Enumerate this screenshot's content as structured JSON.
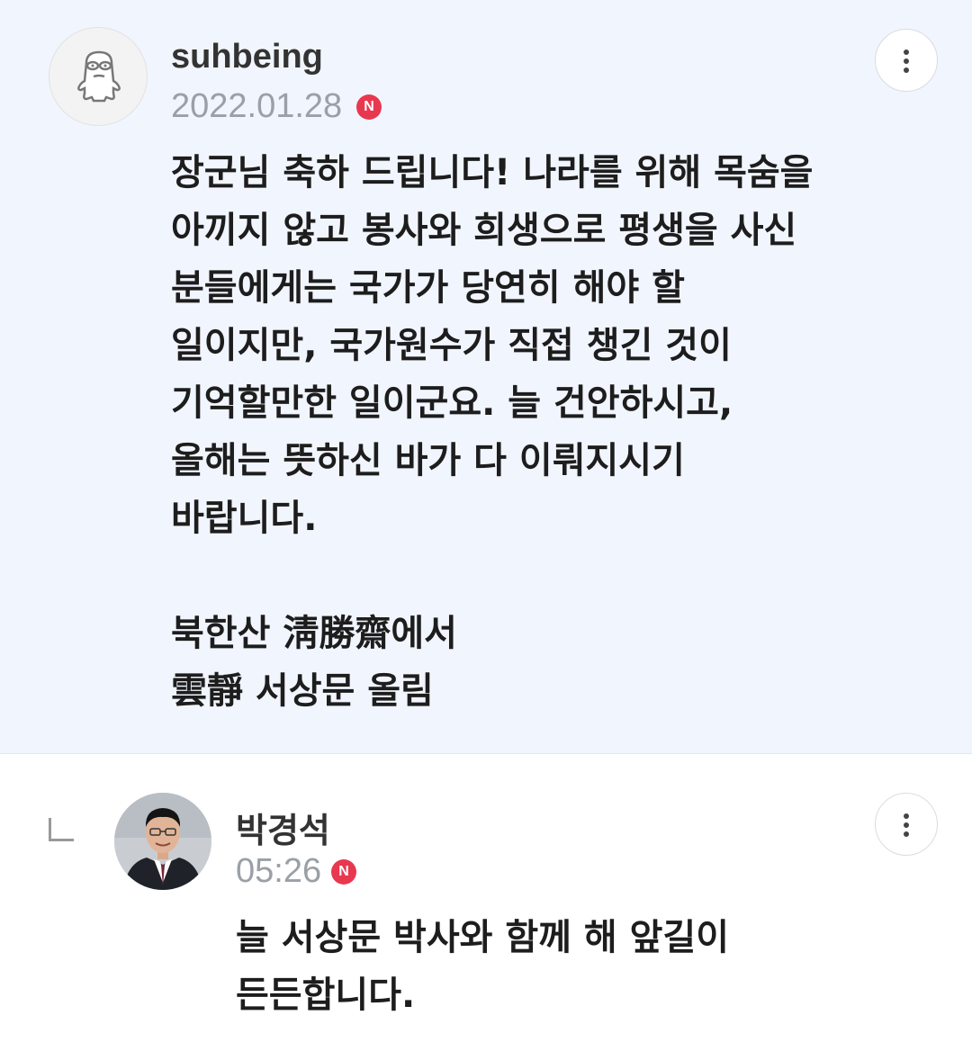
{
  "comments": [
    {
      "author": "suhbeing",
      "date": "2022.01.28",
      "badge": "N",
      "text": "장군님 축하 드립니다! 나라를 위해 목숨을\n아끼지 않고 봉사와 희생으로 평생을 사신\n분들에게는 국가가 당연히 해야 할\n일이지만, 국가원수가 직접 챙긴 것이\n기억할만한 일이군요. 늘 건안하시고,\n올해는 뜻하신 바가 다 이뤄지시기\n바랍니다.\n\n북한산 淸勝齋에서\n雲靜 서상문 올림",
      "avatar_icon": "character-face-icon",
      "more_icon": "more-vertical-icon"
    },
    {
      "author": "박경석",
      "time": "05:26",
      "badge": "N",
      "text": "늘 서상문 박사와 함께 해 앞길이\n든든합니다.",
      "more_icon": "more-vertical-icon",
      "reply_icon": "reply-arrow-icon"
    }
  ],
  "colors": {
    "highlight_bg": "#f1f5fd",
    "badge": "#e8384f",
    "date_text": "#9aa0a6"
  }
}
